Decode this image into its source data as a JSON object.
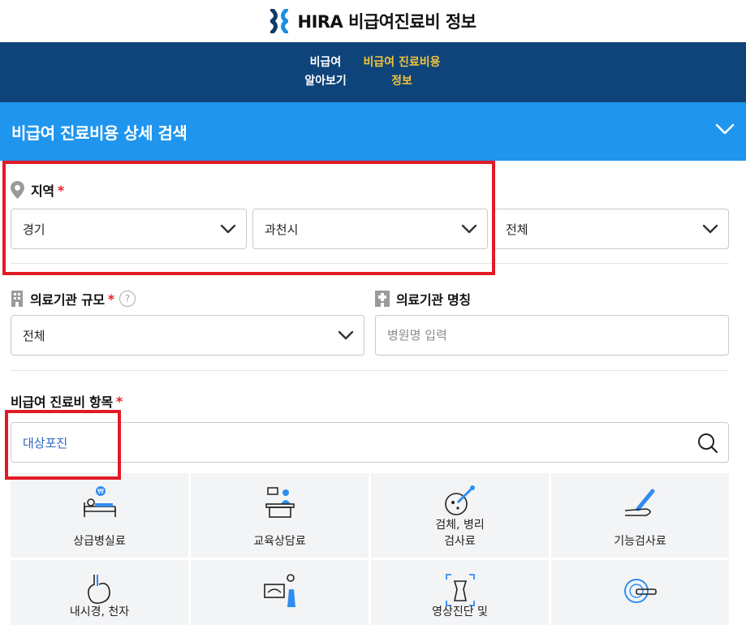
{
  "header": {
    "title": "HIRA 비급여진료비 정보"
  },
  "gnb": {
    "items": [
      {
        "label": "비급여\n알아보기"
      },
      {
        "label": "비급여 진료비용\n정보"
      }
    ]
  },
  "section": {
    "title": "비급여 진료비용 상세 검색"
  },
  "region": {
    "label": "지역",
    "required": "*",
    "selects": [
      {
        "value": "경기"
      },
      {
        "value": "과천시"
      },
      {
        "value": "전체"
      }
    ]
  },
  "institution_scale": {
    "label": "의료기관 규모",
    "required": "*",
    "help": "?",
    "value": "전체"
  },
  "institution_name": {
    "label": "의료기관 명칭",
    "placeholder": "병원명 입력"
  },
  "items_search": {
    "label": "비급여 진료비 항목",
    "required": "*",
    "value": "대상포진"
  },
  "categories": [
    {
      "label": "상급병실료",
      "icon": "hospital-bed-icon"
    },
    {
      "label": "교육상담료",
      "icon": "counseling-icon"
    },
    {
      "label": "검체, 병리\n검사료",
      "icon": "microscope-icon"
    },
    {
      "label": "기능검사료",
      "icon": "thermometer-icon"
    },
    {
      "label": "내시경, 천자",
      "icon": "stomach-icon"
    },
    {
      "label": "",
      "icon": "ultrasound-icon"
    },
    {
      "label": "영상진단 및",
      "icon": "xray-icon"
    },
    {
      "label": "",
      "icon": "ct-scanner-icon"
    }
  ],
  "colors": {
    "nav": "#0e4479",
    "section": "#1f95ee",
    "accent_yellow": "#f5c33b",
    "required": "#e5222b",
    "highlight": "#e11b26"
  }
}
